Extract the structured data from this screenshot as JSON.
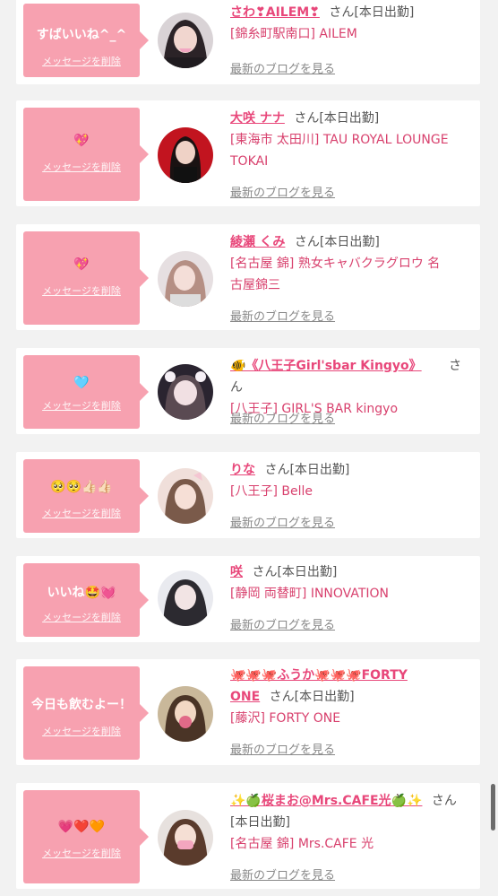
{
  "common": {
    "san": "さん",
    "status": "[本日出勤]",
    "delete_label": "メッセージを削除",
    "blog_label": "最新のブログを見る"
  },
  "items": [
    {
      "message": "すばいいね^_^",
      "name": "さわ❣AILEM❣",
      "show_status": true,
      "shop_lines": [
        "[錦糸町駅南口] AILEM"
      ]
    },
    {
      "message": "💖",
      "name": "大咲 ナナ",
      "show_status": true,
      "shop_lines": [
        "[東海市 太田川] TAU ROYAL LOUNGE",
        "TOKAI"
      ]
    },
    {
      "message": "💖",
      "name": "綾瀬 くみ",
      "show_status": true,
      "shop_lines": [
        "[名古屋 錦] 熟女キャバクラグロウ 名",
        "古屋錦三"
      ]
    },
    {
      "message": "🩵",
      "name": "🐠《八王子Girl'sbar Kingyo》",
      "show_status": false,
      "shop_lines": [
        "[八王子] GIRL'S BAR kingyo"
      ]
    },
    {
      "message": "🥺🥺👍🏻👍🏻",
      "name": "りな",
      "show_status": true,
      "shop_lines": [
        "[八王子] Belle"
      ]
    },
    {
      "message": "いいね🤩💓",
      "name": "咲",
      "show_status": true,
      "shop_lines": [
        "[静岡 両替町] INNOVATION"
      ]
    },
    {
      "message": "今日も飲むよー！",
      "name_lines": [
        "🐙🐙🐙ふうか🐙🐙🐙FORTY",
        "ONE"
      ],
      "show_status": true,
      "shop_lines": [
        "[藤沢] FORTY ONE"
      ]
    },
    {
      "message": "💗❤️🧡",
      "name": "✨🍏桜まお@Mrs.CAFE光🍏✨",
      "show_status": true,
      "shop_lines": [
        "[名古屋 錦] Mrs.CAFE 光"
      ]
    }
  ],
  "icons": [
    "avatar-photo-icon",
    "scrollbar-thumb"
  ],
  "colors": {
    "accent": "#e8477a",
    "bubble": "#f7a1b0",
    "background": "#f2f2f2"
  }
}
